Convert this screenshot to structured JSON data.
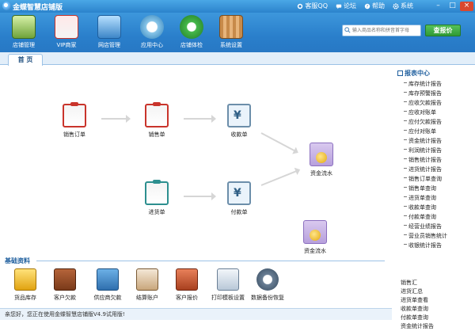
{
  "app": {
    "title": "金蝶智慧店铺版"
  },
  "title_links": [
    {
      "label": "客服QQ",
      "icon": "qq-icon"
    },
    {
      "label": "论坛",
      "icon": "forum-icon"
    },
    {
      "label": "帮助",
      "icon": "help-icon"
    },
    {
      "label": "系统",
      "icon": "settings-icon"
    }
  ],
  "toolbar": {
    "items": [
      {
        "label": "店铺管理",
        "icon": "store-icon"
      },
      {
        "label": "VIP商家",
        "icon": "vip-icon"
      },
      {
        "label": "网店管理",
        "icon": "online-store-icon"
      },
      {
        "label": "应用中心",
        "icon": "app-center-icon"
      },
      {
        "label": "店铺体检",
        "icon": "checkup-icon"
      },
      {
        "label": "系统设置",
        "icon": "system-settings-icon"
      }
    ],
    "search_placeholder": "输入商品名称和拼音首字母",
    "search_button": "查报价"
  },
  "tabs": [
    {
      "label": "首 页"
    }
  ],
  "flow": {
    "nodes": [
      {
        "label": "销售订单",
        "icon": "sales-order-icon"
      },
      {
        "label": "销售单",
        "icon": "sales-invoice-icon"
      },
      {
        "label": "收款单",
        "icon": "receipt-icon"
      },
      {
        "label": "资金流水",
        "icon": "cash-flow-icon"
      },
      {
        "label": "进货单",
        "icon": "purchase-icon"
      },
      {
        "label": "付款单",
        "icon": "payment-icon"
      },
      {
        "label": "资金流水",
        "icon": "cash-flow-icon"
      }
    ]
  },
  "reports": {
    "heading": "报表中心",
    "items": [
      "库存统计报告",
      "库存预警报告",
      "应收欠款报告",
      "应收对账单",
      "应付欠款报告",
      "应付对账单",
      "资金统计报告",
      "利润统计报告",
      "销售统计报告",
      "进货统计报告",
      "销售订单查询",
      "销售单查询",
      "进货单查询",
      "收款单查询",
      "付款单查询",
      "经营业绩报告",
      "营业员销售统计",
      "收银统计报告"
    ],
    "overflow_items": [
      "销售汇",
      "进货汇总",
      "进货单查看",
      "收款单查询",
      "付款单查询",
      "资金统计报告"
    ]
  },
  "basic": {
    "heading": "基础资料",
    "items": [
      {
        "label": "货品库存",
        "icon": "inventory-icon"
      },
      {
        "label": "客户欠款",
        "icon": "customer-debt-icon"
      },
      {
        "label": "供应商欠款",
        "icon": "supplier-debt-icon"
      },
      {
        "label": "结算账户",
        "icon": "account-icon"
      },
      {
        "label": "客户报价",
        "icon": "quote-icon"
      },
      {
        "label": "打印模板设置",
        "icon": "printer-icon"
      },
      {
        "label": "数据备份恢复",
        "icon": "backup-icon"
      }
    ]
  },
  "status": {
    "text": "亲您好，您正在使用金蝶智慧店铺版V4.9试用版!"
  }
}
